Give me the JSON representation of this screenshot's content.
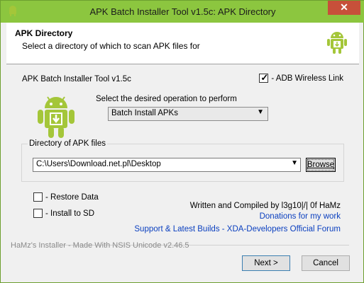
{
  "window": {
    "title": "APK Batch Installer Tool v1.5c: APK Directory",
    "close_label": "✕"
  },
  "header": {
    "title": "APK Directory",
    "subtitle": "Select a directory of which to scan APK files for"
  },
  "main": {
    "tool_name": "APK Batch Installer Tool v1.5c",
    "adb_wireless": {
      "label": "- ADB Wireless Link",
      "checked": true
    },
    "operation_label": "Select the desired operation to perform",
    "operation_selected": "Batch Install APKs",
    "directory_group_title": "Directory of APK files",
    "directory_value": "C:\\Users\\Download.net.pl\\Desktop",
    "browse_label": "Browse",
    "options": [
      {
        "label": "- Restore Data",
        "checked": false
      },
      {
        "label": "- Install to SD",
        "checked": false
      }
    ],
    "credit": "Written and Compiled by l3g10|/| 0f HaMz",
    "links": [
      "Donations for my work",
      "Support & Latest Builds - XDA-Developers Official Forum"
    ]
  },
  "footer": {
    "branding": "HaMz's Installer - Made With NSIS Unicode v2.46.5",
    "next_label": "Next >",
    "cancel_label": "Cancel"
  },
  "colors": {
    "title_bar": "#8cc63f",
    "link": "#0a3fbf",
    "android_green": "#a4c639"
  },
  "icons": [
    "android-icon",
    "android-download-icon",
    "close-icon",
    "checkbox-icon",
    "chevron-down-icon"
  ]
}
